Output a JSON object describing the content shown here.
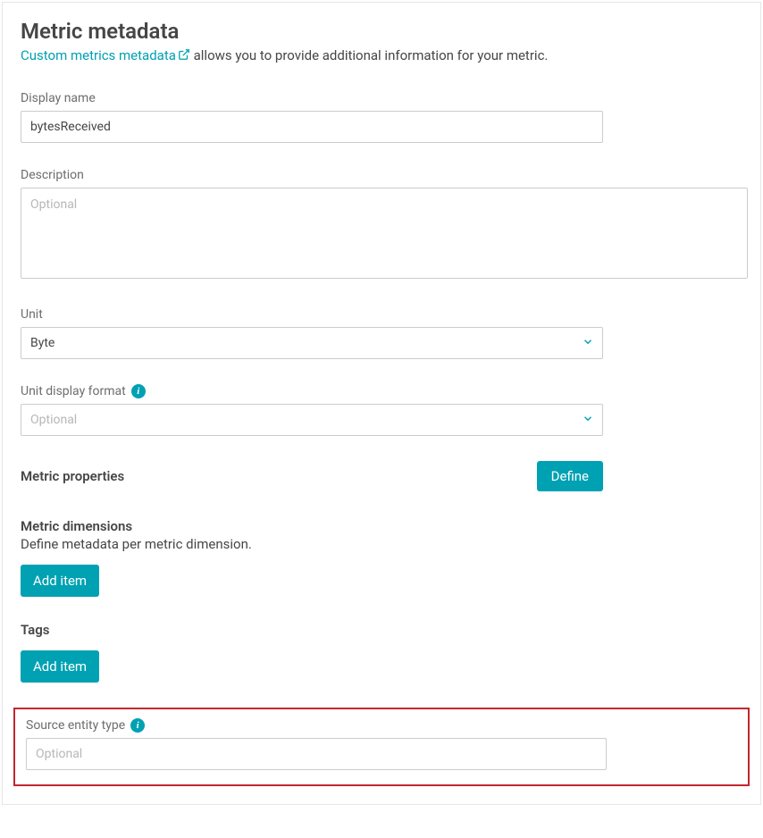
{
  "title": "Metric metadata",
  "subtitle": {
    "link_text": "Custom metrics metadata",
    "after_text": " allows you to provide additional information for your metric."
  },
  "display_name": {
    "label": "Display name",
    "value": "bytesReceived"
  },
  "description": {
    "label": "Description",
    "placeholder": "Optional",
    "value": ""
  },
  "unit": {
    "label": "Unit",
    "value": "Byte"
  },
  "unit_display_format": {
    "label": "Unit display format",
    "placeholder": "Optional",
    "value": ""
  },
  "metric_properties": {
    "label": "Metric properties",
    "define_button": "Define"
  },
  "metric_dimensions": {
    "label": "Metric dimensions",
    "desc": "Define metadata per metric dimension.",
    "add_button": "Add item"
  },
  "tags": {
    "label": "Tags",
    "add_button": "Add item"
  },
  "source_entity_type": {
    "label": "Source entity type",
    "placeholder": "Optional",
    "value": ""
  }
}
